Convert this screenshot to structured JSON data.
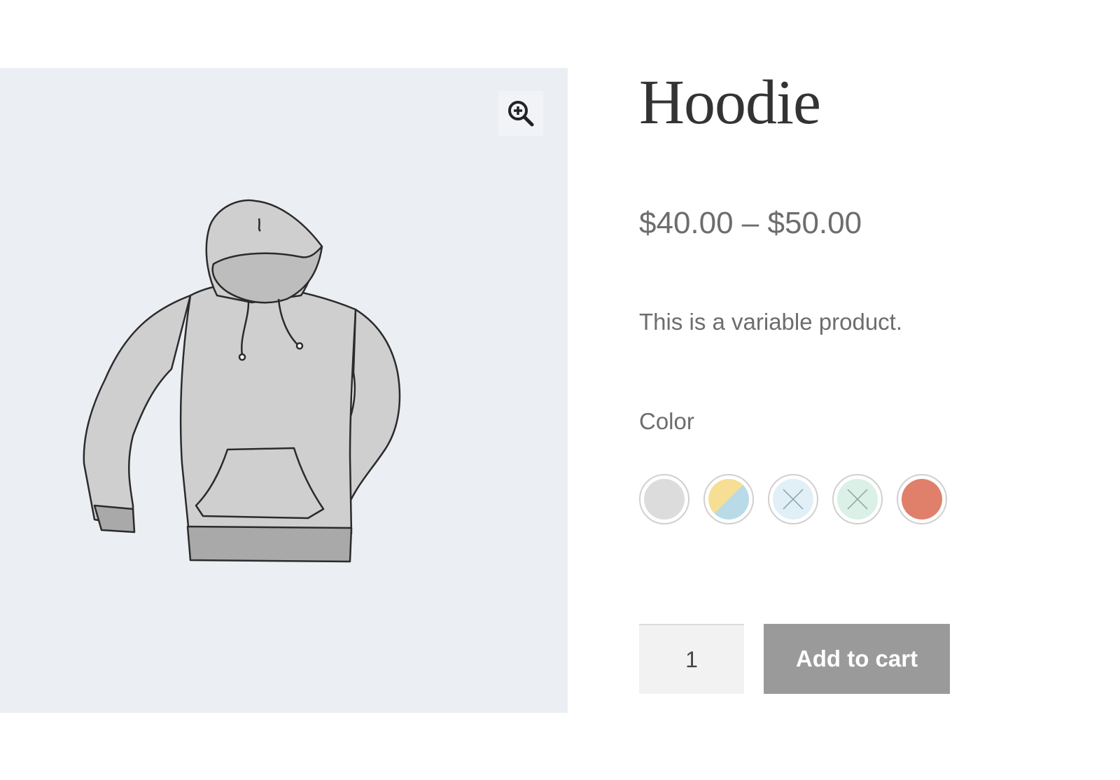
{
  "product": {
    "title": "Hoodie",
    "price": "$40.00 – $50.00",
    "description": "This is a variable product."
  },
  "variation": {
    "label": "Color",
    "swatches": [
      {
        "name": "grey",
        "color": "#dcdcdc",
        "available": true
      },
      {
        "name": "yellow-blue",
        "colors": [
          "#f6df94",
          "#b9dbe8"
        ],
        "available": true
      },
      {
        "name": "light-blue",
        "color": "#e1eff6",
        "available": false
      },
      {
        "name": "mint",
        "color": "#dbf0e7",
        "available": false
      },
      {
        "name": "red",
        "color": "#e0806a",
        "available": true
      }
    ]
  },
  "cart": {
    "quantity": "1",
    "add_to_cart_label": "Add to cart"
  },
  "icons": {
    "zoom": "zoom-in-icon"
  },
  "colors": {
    "gallery_bg": "#ebeff4",
    "button_bg": "#9a9a9a",
    "title": "#333333",
    "text": "#6d6d6d"
  }
}
